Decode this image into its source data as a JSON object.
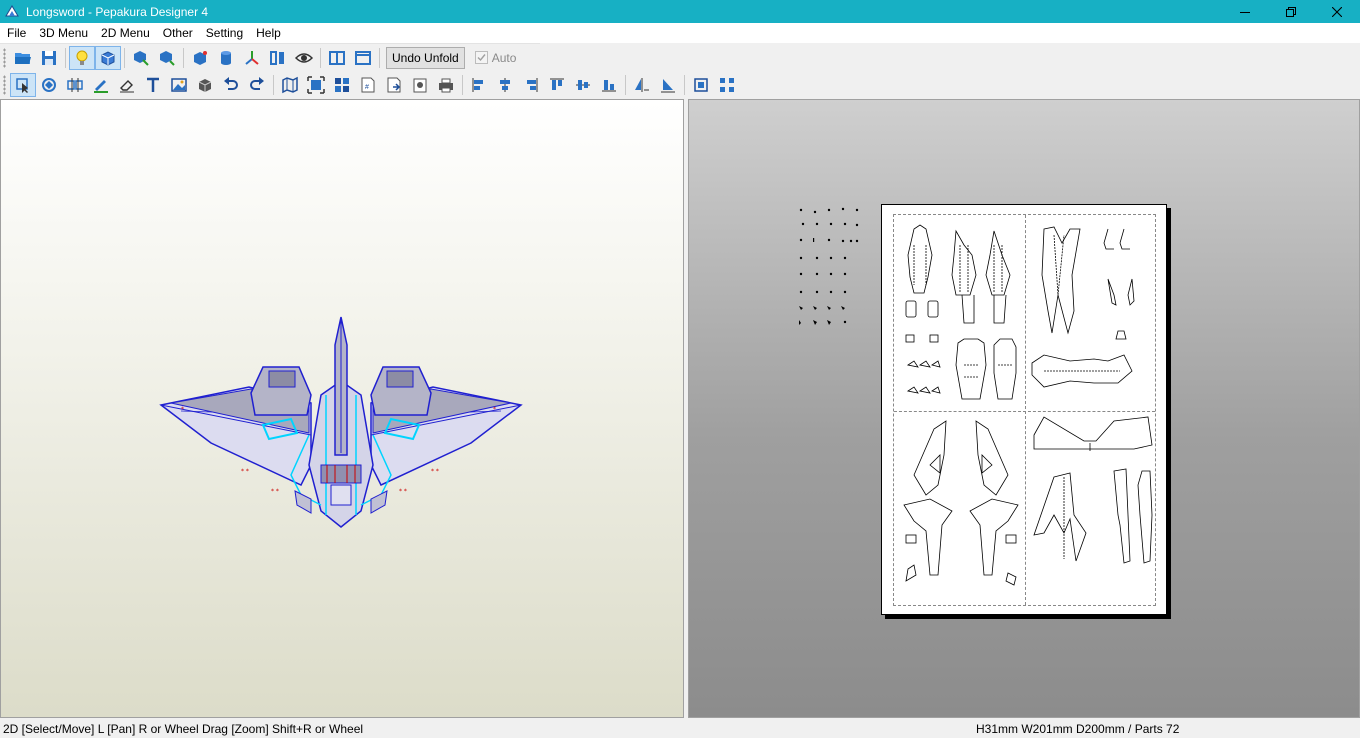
{
  "window": {
    "title": "Longsword - Pepakura Designer 4",
    "title_bar_color": "#17b0c4"
  },
  "menu": [
    "File",
    "3D Menu",
    "2D Menu",
    "Other",
    "Setting",
    "Help"
  ],
  "toolbar": {
    "undo_unfold": "Undo Unfold",
    "auto_label": "Auto"
  },
  "status": {
    "hint": "2D [Select/Move] L [Pan] R or Wheel Drag [Zoom] Shift+R or Wheel",
    "dims": "H31mm W201mm D200mm / Parts 72"
  },
  "colors": {
    "model_edge": "#2020d0",
    "model_highlight": "#00d4ff",
    "fold_mark": "#cc0000"
  },
  "icons": {
    "toolbar1": [
      "open-folder-icon",
      "save-icon",
      "lightbulb-icon",
      "texture-view-icon",
      "cube-select-icon",
      "cube-rotate-icon",
      "box-icon",
      "cylinder-icon",
      "axis-icon",
      "columns-icon",
      "eye-icon",
      "split-view-icon",
      "single-view-icon"
    ],
    "toolbar2": [
      "select-move-icon",
      "rotate-part-icon",
      "join-parts-icon",
      "pencil-icon",
      "eraser-icon",
      "text-icon",
      "image-icon",
      "cube-icon",
      "undo-icon",
      "redo-icon",
      "map-icon",
      "fit-icon",
      "grid-icon",
      "page-number-icon",
      "export-icon",
      "print-preview-icon",
      "print-icon",
      "align-left-icon",
      "align-center-icon",
      "align-right-icon",
      "align-top-icon",
      "align-middle-icon",
      "align-bottom-icon",
      "flip-horizontal-icon",
      "flip-vertical-icon",
      "group-icon",
      "ungroup-icon"
    ]
  }
}
